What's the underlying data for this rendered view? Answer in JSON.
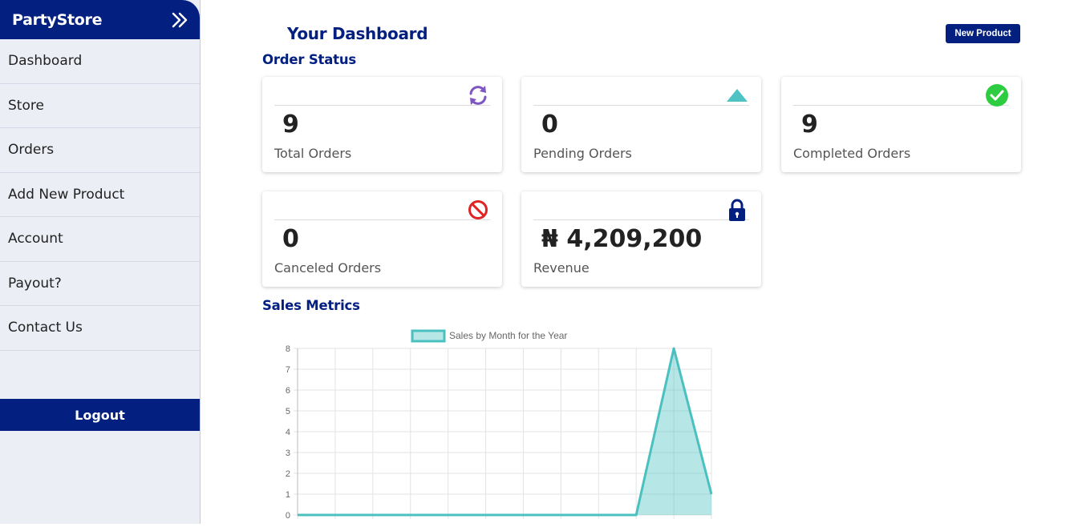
{
  "sidebar": {
    "brand": "PartyStore",
    "items": [
      {
        "label": "Dashboard"
      },
      {
        "label": "Store"
      },
      {
        "label": "Orders"
      },
      {
        "label": "Add New Product"
      },
      {
        "label": "Account"
      },
      {
        "label": "Payout?"
      },
      {
        "label": "Contact Us"
      }
    ],
    "logout": "Logout"
  },
  "header": {
    "title": "Your Dashboard",
    "new_product": "New Product"
  },
  "order_status": {
    "title": "Order Status",
    "cards": [
      {
        "value": "9",
        "label": "Total Orders",
        "icon": "refresh-icon",
        "color": "#7e57c2"
      },
      {
        "value": "0",
        "label": "Pending Orders",
        "icon": "triangle-up-icon",
        "color": "#4fc3c3"
      },
      {
        "value": "9",
        "label": "Completed Orders",
        "icon": "check-circle-icon",
        "color": "#2ecc40"
      },
      {
        "value": "0",
        "label": "Canceled Orders",
        "icon": "ban-icon",
        "color": "#e02424"
      },
      {
        "value": "₦ 4,209,200",
        "label": "Revenue",
        "icon": "lock-icon",
        "color": "#032081"
      }
    ]
  },
  "sales": {
    "title": "Sales Metrics"
  },
  "colors": {
    "primary": "#032081",
    "chart_line": "#4bc0c0",
    "chart_fill": "rgba(75,192,192,0.4)"
  },
  "chart_data": {
    "type": "area",
    "legend": "Sales by Month for the Year",
    "legend_position": "top",
    "grid": true,
    "ylim": [
      0,
      8
    ],
    "yticks": [
      "0",
      "1",
      "2",
      "3",
      "4",
      "5",
      "6",
      "7",
      "8"
    ],
    "series": [
      {
        "name": "Sales by Month for the Year",
        "values": [
          0,
          0,
          0,
          0,
          0,
          0,
          0,
          0,
          0,
          0,
          8,
          1
        ]
      }
    ]
  }
}
